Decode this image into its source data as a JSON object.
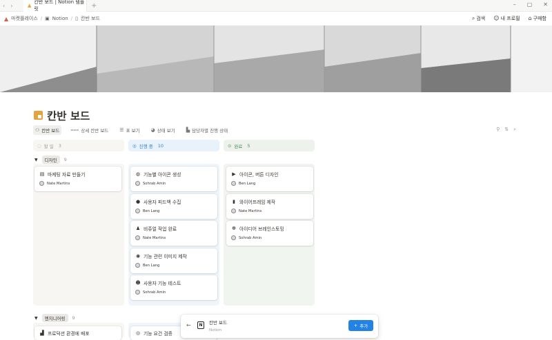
{
  "window": {
    "tab_title": "칸반 보드 | Notion 템플릿",
    "new_tab": "+",
    "minimize": "–",
    "restore": "▢",
    "close": "✕"
  },
  "breadcrumb": {
    "items": [
      "마켓플레이스",
      "Notion",
      "칸반 보드"
    ]
  },
  "top_actions": {
    "search": "검색",
    "profile": "내 프로필",
    "purchases": "구매함"
  },
  "page": {
    "title": "칸반 보드"
  },
  "views": [
    {
      "label": "칸반 보드",
      "icon": "kanban-icon"
    },
    {
      "label": "상세 칸반 보드",
      "icon": "kanban-detail-icon"
    },
    {
      "label": "표 보기",
      "icon": "table-icon"
    },
    {
      "label": "상태 보기",
      "icon": "status-icon"
    },
    {
      "label": "담당자별 진행 상태",
      "icon": "timeline-icon"
    }
  ],
  "columns": [
    {
      "label": "할 일",
      "count": "3",
      "color": "#9b9a97",
      "bg": "#f1f1ef",
      "icon": "todo-circle-icon"
    },
    {
      "label": "진행 중",
      "count": "10",
      "color": "#2e7fd1",
      "bg": "#e7f2fb",
      "icon": "in-progress-icon"
    },
    {
      "label": "완료",
      "count": "5",
      "color": "#4a8c5c",
      "bg": "#edf3ec",
      "icon": "done-check-icon"
    }
  ],
  "groups": [
    {
      "label": "디자인",
      "count": "9"
    },
    {
      "label": "엔지니어링",
      "count": "9"
    }
  ],
  "cards": {
    "todo": [
      {
        "title": "마케팅 자료 만들기",
        "assignee": "Nate Martins",
        "icon": "document-icon"
      }
    ],
    "in_progress": [
      {
        "title": "기능별 아이콘 생성",
        "assignee": "Sohrab Amin",
        "icon": "icons-icon"
      },
      {
        "title": "사용자 피드백 수집",
        "assignee": "Ben Lang",
        "icon": "chat-bubble-icon"
      },
      {
        "title": "비쥬얼 작업 완료",
        "assignee": "Nate Martins",
        "icon": "palette-icon"
      },
      {
        "title": "기능 관련 이미지 제작",
        "assignee": "Ben Lang",
        "icon": "eye-icon"
      },
      {
        "title": "사용자 기능 테스트",
        "assignee": "Sohrab Amin",
        "icon": "user-icon"
      }
    ],
    "done": [
      {
        "title": "아이콘, 버튼 디자인",
        "assignee": "Ben Lang",
        "icon": "play-icon"
      },
      {
        "title": "와이어프레임 제작",
        "assignee": "Nate Martins",
        "icon": "book-icon"
      },
      {
        "title": "아이디어 브레인스토밍",
        "assignee": "Sohrab Amin",
        "icon": "brain-icon"
      }
    ],
    "eng_todo": [
      {
        "title": "프로덕션 환경에 배포",
        "icon": "deploy-icon"
      }
    ],
    "eng_in_progress": [
      {
        "title": "기능 요건 검증",
        "icon": "check-icon"
      }
    ]
  },
  "popup": {
    "title": "칸반 보드",
    "subtitle": "Notion",
    "add_label": "추가",
    "add_icon": "plus-icon"
  }
}
